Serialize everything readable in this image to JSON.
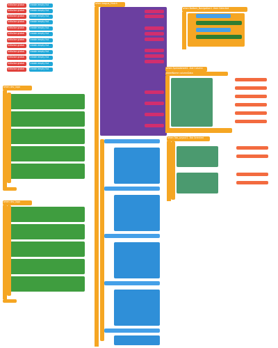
{
  "init_globals": [
    {
      "label": "initialize global",
      "name": "list"
    },
    {
      "label": "initialize global",
      "name": "list"
    },
    {
      "label": "initialize global",
      "name": "list"
    },
    {
      "label": "initialize global",
      "name": "list"
    },
    {
      "label": "initialize global",
      "name": "list"
    },
    {
      "label": "initialize global",
      "name": "list"
    },
    {
      "label": "initialize global",
      "name": "list"
    },
    {
      "label": "initialize global",
      "name": "list"
    },
    {
      "label": "initialize global",
      "name": "list"
    },
    {
      "label": "initialize global",
      "name": "list"
    },
    {
      "label": "initialize global",
      "name": "list"
    },
    {
      "label": "initialize global",
      "name": "list"
    }
  ],
  "init_values": [
    "create empty list",
    "create empty list",
    "create empty list",
    "create empty list",
    "create empty list",
    "create empty list",
    "create empty list",
    "create empty list",
    "create empty list",
    "create empty list",
    "create empty list",
    "create empty list"
  ],
  "screen_init": {
    "header": "when Screen1 .Initialize",
    "do": "do"
  },
  "left_proc": {
    "header": "when  dev_logo",
    "do": "do"
  },
  "left_rows": [
    "dev_logo",
    "Picture",
    "dev_logo",
    "Picture",
    "dev_logo",
    "Picture",
    "dev_logo",
    "Picture",
    "dev_logo",
    "Picture"
  ],
  "left_proc2": {
    "header": "when  dev_logo",
    "do": "do"
  },
  "mid_header": {
    "title": "when  league_Match",
    "do": "do"
  },
  "mid_rows": [
    "call Notifier1 .Show Progress Dialog",
    "message",
    "title",
    "call Bottom_Navigation1 .Add Item",
    "id",
    "title",
    "image",
    "call Bottom_Navigation1 .Add Item",
    "id",
    "title",
    "image",
    "call Tab_Layout1 .Add New Tab",
    "name",
    "call Tab_Layout1 .Add New Tab",
    "name",
    "call Spreadsheet1 .Get Column",
    "sheetName",
    "rowRecord"
  ],
  "bottom_nav": {
    "header": "when Bottom_Navigation1 .Item Selected",
    "id": "id",
    "do": "do"
  },
  "spreadsheet": {
    "header": "when Spreadsheet1 .Got Column",
    "params": "sheetName  columnData",
    "do": "do"
  },
  "tab_layout": {
    "header": "when Tab_Layout1 .Tab Selected",
    "params": "position",
    "do": "do"
  },
  "colors": {
    "event": "#f5a623",
    "proc": "#6b3fa0",
    "text": "#d22e6e",
    "logic": "#2f8fd8",
    "list": "#3f9d3f"
  }
}
